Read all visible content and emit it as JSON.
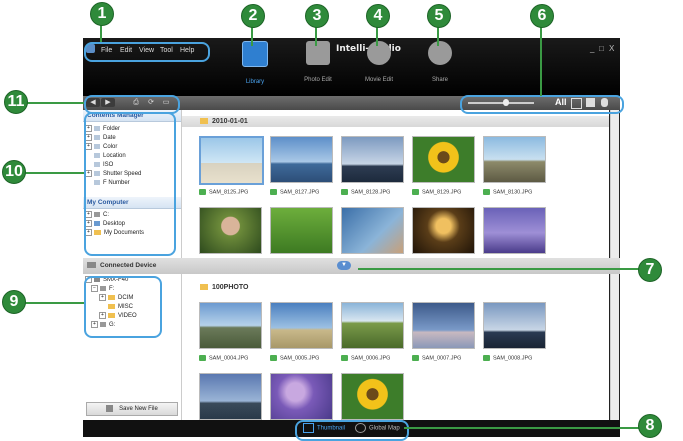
{
  "callouts": [
    "1",
    "2",
    "3",
    "4",
    "5",
    "6",
    "7",
    "8",
    "9",
    "10",
    "11"
  ],
  "app": {
    "title": "Intelli-studio",
    "menu": [
      "File",
      "Edit",
      "View",
      "Tool",
      "Help"
    ],
    "window_controls": [
      "_",
      "□",
      "X"
    ],
    "modes": [
      {
        "label": "Library",
        "icon": "library-icon"
      },
      {
        "label": "Photo Edit",
        "icon": "photo-edit-icon"
      },
      {
        "label": "Movie Edit",
        "icon": "movie-edit-icon"
      },
      {
        "label": "Share",
        "icon": "share-icon"
      }
    ],
    "view_options": {
      "all_label": "All"
    }
  },
  "contents_manager": {
    "title": "Contents Manager",
    "items": [
      "Folder",
      "Date",
      "Color",
      "Location",
      "ISO",
      "Shutter Speed",
      "F Number"
    ]
  },
  "my_computer": {
    "title": "My Computer",
    "items": [
      "C:",
      "Desktop",
      "My Documents"
    ]
  },
  "library": {
    "date_group": "2010-01-01",
    "files": [
      "SAM_8125.JPG",
      "SAM_8127.JPG",
      "SAM_8128.JPG",
      "SAM_8129.JPG",
      "SAM_8130.JPG"
    ]
  },
  "connected_device": {
    "title": "Connected Device",
    "root": "SMX-F40",
    "drive": "F:",
    "folders": [
      "DCIM",
      "MISC",
      "VIDEO"
    ],
    "drive2": "G:",
    "save_button": "Save New File"
  },
  "device_photos": {
    "folder": "100PHOTO",
    "files": [
      "SAM_0004.JPG",
      "SAM_0005.JPG",
      "SAM_0006.JPG",
      "SAM_0007.JPG",
      "SAM_0008.JPG"
    ]
  },
  "status_bar": {
    "thumbnail": "Thumbnail",
    "global_map": "Global Map"
  }
}
